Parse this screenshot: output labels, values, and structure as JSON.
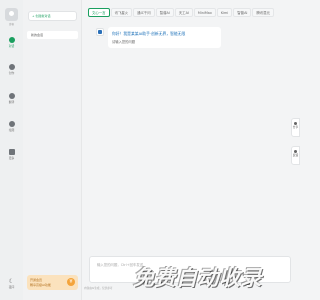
{
  "user": {
    "name": "游客"
  },
  "rail": {
    "items": [
      {
        "label": "对话",
        "icon": "chat-icon",
        "active": true
      },
      {
        "label": "创作",
        "icon": "pen-icon",
        "active": false
      },
      {
        "label": "翻译",
        "icon": "translate-icon",
        "active": false
      },
      {
        "label": "绘图",
        "icon": "paint-icon",
        "active": false
      },
      {
        "label": "更多",
        "icon": "grid-icon",
        "active": false
      }
    ],
    "bottom": {
      "label": "夜间",
      "icon": "moon-icon"
    }
  },
  "conversations": {
    "new_chat_label": "+ 创建新对话",
    "items": [
      "新的会话"
    ]
  },
  "promo": {
    "line1": "开通会员",
    "line2": "畅享高级AI功能",
    "button_glyph": "¥"
  },
  "model_tabs": [
    {
      "label": "文心一言",
      "active": true
    },
    {
      "label": "讯飞星火"
    },
    {
      "label": "通义千问"
    },
    {
      "label": "智谱AI"
    },
    {
      "label": "天工AI"
    },
    {
      "label": "MiniMax"
    },
    {
      "label": "Kimi"
    },
    {
      "label": "智普AI"
    },
    {
      "label": "腾讯混元"
    }
  ],
  "message": {
    "greeting": "你好！我是某某AI助手·创新无界，智能无限",
    "hint": "请输入您的问题"
  },
  "side_buttons": [
    {
      "label": "分享"
    },
    {
      "label": "反馈"
    }
  ],
  "composer": {
    "placeholder": "输入您的问题，Ctrl+回车发送"
  },
  "footer_note": "内容由AI生成，仅供参考",
  "watermark": "免费自动收录",
  "colors": {
    "accent": "#1a9f5f",
    "link": "#1a6fb8",
    "promo_bg": "#fbe2bd",
    "promo_button": "#f4a43b"
  }
}
